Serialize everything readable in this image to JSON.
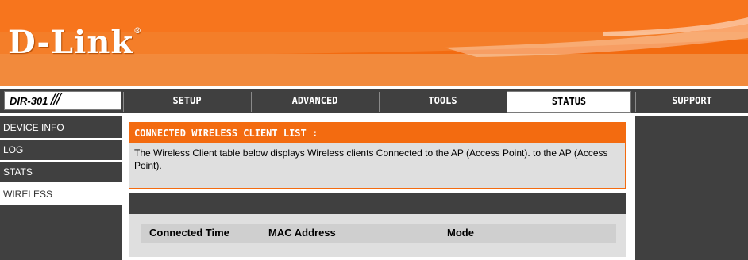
{
  "header": {
    "logo_text": "D-Link",
    "logo_mark": "®"
  },
  "nav": {
    "model": "DIR-301",
    "model_slashes": "///",
    "tabs": [
      {
        "label": "SETUP",
        "active": false
      },
      {
        "label": "ADVANCED",
        "active": false
      },
      {
        "label": "TOOLS",
        "active": false
      },
      {
        "label": "STATUS",
        "active": true
      },
      {
        "label": "SUPPORT",
        "active": false
      }
    ]
  },
  "sidebar": {
    "items": [
      {
        "label": "DEVICE INFO",
        "active": false
      },
      {
        "label": "LOG",
        "active": false
      },
      {
        "label": "STATS",
        "active": false
      },
      {
        "label": "WIRELESS",
        "active": true
      }
    ]
  },
  "main": {
    "section_title": "CONNECTED WIRELESS CLIENT LIST :",
    "description": "The Wireless Client table below displays Wireless clients Connected to the AP (Access Point). to the AP (Access Point).",
    "table": {
      "columns": [
        "Connected Time",
        "MAC Address",
        "Mode"
      ]
    }
  },
  "colors": {
    "brand_orange": "#f36b10",
    "nav_dark": "#404040",
    "panel_gray": "#dfdfdf"
  }
}
